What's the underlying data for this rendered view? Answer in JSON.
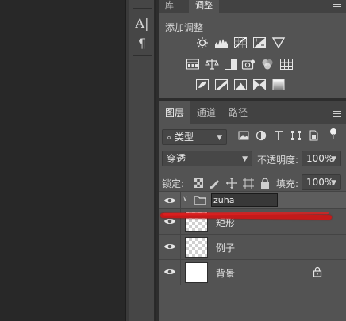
{
  "top_panel": {
    "tabs": [
      {
        "label": "库",
        "active": false
      },
      {
        "label": "调整",
        "active": true
      }
    ],
    "adjustments_title": "添加调整",
    "adjust_icons": [
      "brightness-icon",
      "levels-icon",
      "curves-icon",
      "exposure-icon",
      "vibrance-icon",
      "hue-saturation-icon",
      "color-balance-icon",
      "black-white-icon",
      "photo-filter-icon",
      "channel-mixer-icon",
      "color-lookup-icon",
      "invert-icon",
      "posterize-icon",
      "threshold-icon",
      "selective-color-icon",
      "gradient-map-icon"
    ]
  },
  "layers_panel": {
    "tabs": [
      {
        "label": "图层",
        "active": true
      },
      {
        "label": "通道",
        "active": false
      },
      {
        "label": "路径",
        "active": false
      }
    ],
    "filter": {
      "kind_label": "类型",
      "search_icon": "search-icon"
    },
    "blend_mode": "穿透",
    "opacity_label": "不透明度:",
    "opacity_value": "100%",
    "lock_label": "锁定:",
    "fill_label": "填充:",
    "fill_value": "100%",
    "layers": [
      {
        "type": "group",
        "name": "zuha",
        "editing": true
      },
      {
        "type": "layer",
        "name": "矩形",
        "thumb": "transparent"
      },
      {
        "type": "layer",
        "name": "例子",
        "thumb": "transparent"
      },
      {
        "type": "layer",
        "name": "背景",
        "thumb": "white",
        "locked": true
      }
    ]
  },
  "tools": [
    {
      "icon": "character-panel-icon",
      "glyph": "A|"
    },
    {
      "icon": "paragraph-panel-icon",
      "glyph": "¶"
    }
  ],
  "colors": {
    "panel_bg": "#535353",
    "canvas_bg": "#282828",
    "annotation_red": "#c41a1a"
  }
}
